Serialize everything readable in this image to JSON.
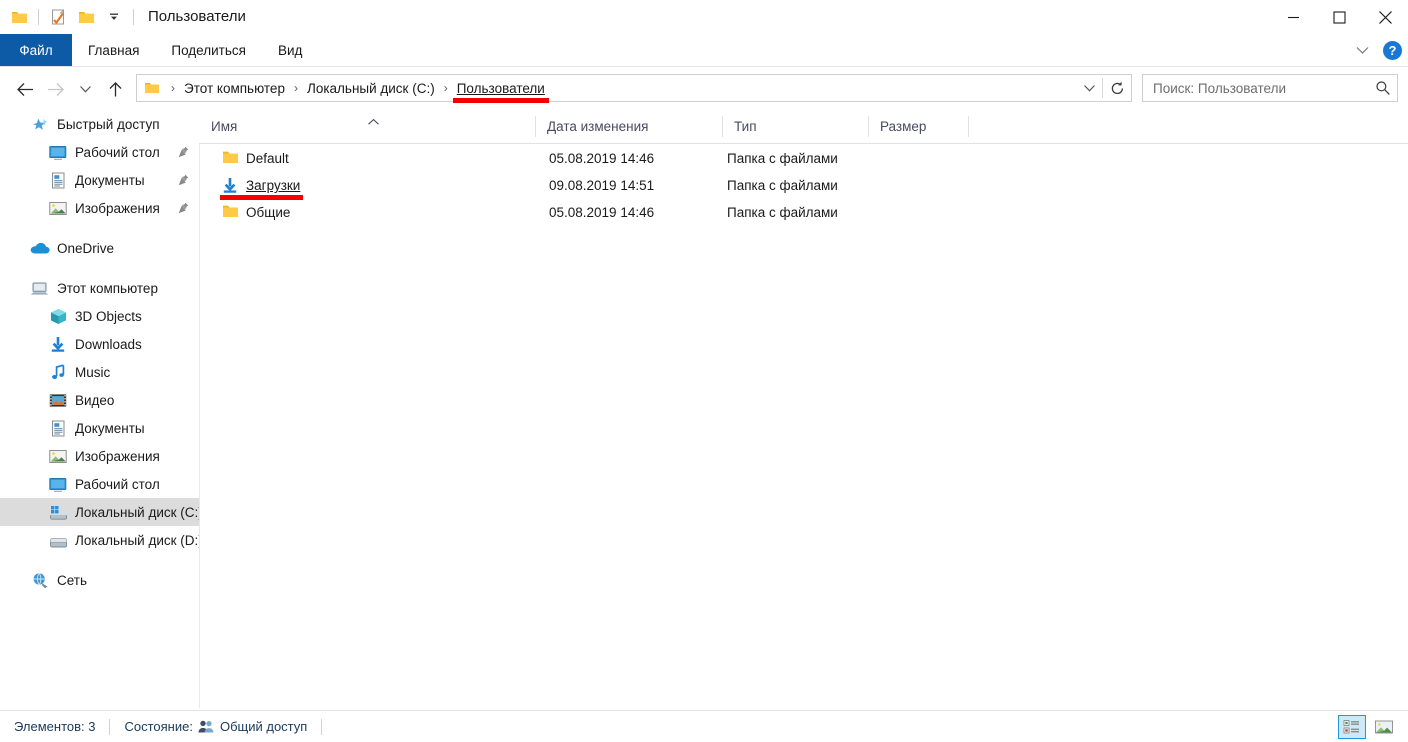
{
  "window": {
    "title": "Пользователи",
    "quick_access_icons": [
      "folder-icon",
      "properties-icon",
      "new-folder-icon",
      "customize-qat-dropdown-icon"
    ],
    "controls": {
      "minimize": "minimize-icon",
      "maximize": "maximize-icon",
      "close": "close-icon"
    }
  },
  "ribbon": {
    "tabs": [
      {
        "label": "Файл",
        "active": true
      },
      {
        "label": "Главная",
        "active": false
      },
      {
        "label": "Поделиться",
        "active": false
      },
      {
        "label": "Вид",
        "active": false
      }
    ],
    "collapse_icon": "chevron-down-icon",
    "help_label": "?"
  },
  "nav": {
    "back_icon": "arrow-left-icon",
    "forward_icon": "arrow-right-icon",
    "recent_icon": "chevron-down-icon",
    "up_icon": "arrow-up-icon",
    "breadcrumb_icon": "folder-icon",
    "breadcrumbs": [
      {
        "label": "Этот компьютер",
        "current": false
      },
      {
        "label": "Локальный диск (C:)",
        "current": false
      },
      {
        "label": "Пользователи",
        "current": true
      }
    ],
    "separator": "›",
    "dropdown_icon": "chevron-down-icon",
    "refresh_icon": "refresh-icon"
  },
  "search": {
    "placeholder": "Поиск: Пользователи",
    "icon": "search-icon"
  },
  "sidebar": {
    "items": [
      {
        "label": "Быстрый доступ",
        "icon": "quick-access-star-icon",
        "level": 0,
        "pinned": false,
        "selected": false
      },
      {
        "label": "Рабочий стол",
        "icon": "desktop-icon",
        "level": 1,
        "pinned": true,
        "selected": false
      },
      {
        "label": "Документы",
        "icon": "documents-icon",
        "level": 1,
        "pinned": true,
        "selected": false
      },
      {
        "label": "Изображения",
        "icon": "pictures-icon",
        "level": 1,
        "pinned": true,
        "selected": false
      },
      {
        "label": "OneDrive",
        "icon": "onedrive-cloud-icon",
        "level": 0,
        "pinned": false,
        "selected": false,
        "gap_before": true
      },
      {
        "label": "Этот компьютер",
        "icon": "this-pc-icon",
        "level": 0,
        "pinned": false,
        "selected": false,
        "gap_before": true
      },
      {
        "label": "3D Objects",
        "icon": "3d-objects-icon",
        "level": 1,
        "pinned": false,
        "selected": false
      },
      {
        "label": "Downloads",
        "icon": "downloads-arrow-icon",
        "level": 1,
        "pinned": false,
        "selected": false
      },
      {
        "label": "Music",
        "icon": "music-note-icon",
        "level": 1,
        "pinned": false,
        "selected": false
      },
      {
        "label": "Видео",
        "icon": "videos-icon",
        "level": 1,
        "pinned": false,
        "selected": false
      },
      {
        "label": "Документы",
        "icon": "documents-icon",
        "level": 1,
        "pinned": false,
        "selected": false
      },
      {
        "label": "Изображения",
        "icon": "pictures-icon",
        "level": 1,
        "pinned": false,
        "selected": false
      },
      {
        "label": "Рабочий стол",
        "icon": "desktop-icon",
        "level": 1,
        "pinned": false,
        "selected": false
      },
      {
        "label": "Локальный диск (C:)",
        "icon": "system-drive-icon",
        "level": 1,
        "pinned": false,
        "selected": true
      },
      {
        "label": "Локальный диск (D:)",
        "icon": "drive-icon",
        "level": 1,
        "pinned": false,
        "selected": false
      },
      {
        "label": "Сеть",
        "icon": "network-icon",
        "level": 0,
        "pinned": false,
        "selected": false,
        "gap_before": true
      }
    ]
  },
  "filelist": {
    "columns": [
      {
        "label": "Имя",
        "sorted": "asc"
      },
      {
        "label": "Дата изменения",
        "sorted": ""
      },
      {
        "label": "Тип",
        "sorted": ""
      },
      {
        "label": "Размер",
        "sorted": ""
      }
    ],
    "sort_icon": "chevron-up-icon",
    "rows": [
      {
        "name": "Default",
        "icon": "folder-icon",
        "date": "05.08.2019 14:46",
        "type": "Папка с файлами",
        "size": "",
        "annotated": false
      },
      {
        "name": "Загрузки",
        "icon": "downloads-arrow-icon",
        "date": "09.08.2019 14:51",
        "type": "Папка с файлами",
        "size": "",
        "annotated": true
      },
      {
        "name": "Общие",
        "icon": "folder-icon",
        "date": "05.08.2019 14:46",
        "type": "Папка с файлами",
        "size": "",
        "annotated": false
      }
    ]
  },
  "statusbar": {
    "count_label": "Элементов: 3",
    "state_label": "Состояние:",
    "share_label": "Общий доступ",
    "share_icon": "shared-users-icon",
    "views": [
      {
        "name": "details-view",
        "icon": "details-view-icon",
        "active": true
      },
      {
        "name": "large-icons-view",
        "icon": "large-icons-view-icon",
        "active": false
      }
    ]
  },
  "annotations": {
    "color": "#f50000",
    "marks": [
      "breadcrumb-пользователи-underline",
      "row-загрузки-underline"
    ]
  }
}
